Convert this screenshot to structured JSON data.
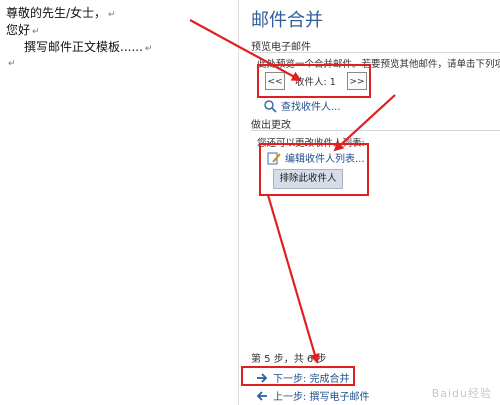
{
  "document": {
    "lines": [
      "尊敬的先生/女士，",
      "您好",
      "撰写邮件正文模板......"
    ],
    "para_mark": "↵"
  },
  "pane": {
    "title": "邮件合并",
    "preview_label": "预览电子邮件",
    "preview_desc": "此处预览一个合并邮件。若要预览其他邮件，请单击下列项",
    "prev_btn": "<<",
    "recipient": "收件人: 1",
    "next_btn": ">>",
    "find_recipient": "查找收件人...",
    "make_changes_label": "做出更改",
    "changes_desc": "您还可以更改收件人列表:",
    "edit_list": "编辑收件人列表...",
    "exclude_btn": "排除此收件人",
    "step_info": "第 5 步，共 6 步",
    "next_step": "下一步: 完成合并",
    "prev_step": "上一步: 撰写电子邮件"
  },
  "watermark": "Baidu经验",
  "colors": {
    "title": "#2f5f9b",
    "highlight": "#e02020",
    "link": "#1f4f8f"
  }
}
